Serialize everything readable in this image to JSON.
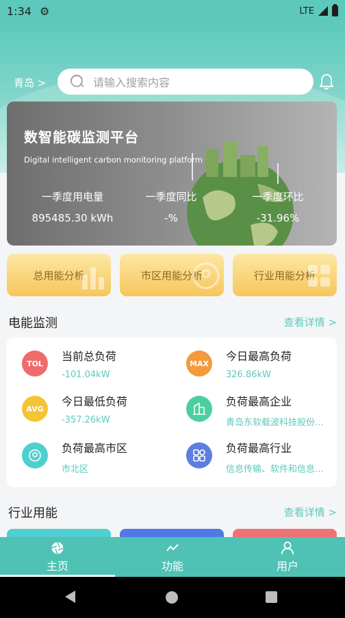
{
  "status_bar": {
    "time": "1:34",
    "network": "LTE"
  },
  "header": {
    "city": "青岛 >",
    "search_placeholder": "请输入搜索内容"
  },
  "hero": {
    "title": "数智能碳监测平台",
    "subtitle": "Digital intelligent carbon monitoring platform",
    "stats": [
      {
        "label": "一季度用电量",
        "value": "895485.30 kWh"
      },
      {
        "label": "一季度同比",
        "value": "-%"
      },
      {
        "label": "一季度环比",
        "value": "-31.96%"
      }
    ]
  },
  "analysis_buttons": [
    {
      "label": "总用能分析"
    },
    {
      "label": "市区用能分析"
    },
    {
      "label": "行业用能分析"
    }
  ],
  "power_monitor": {
    "title": "电能监测",
    "more": "查看详情 >",
    "items": [
      {
        "badge": "TOL",
        "label": "当前总负荷",
        "value": "-101.04kW",
        "color": "#f06b6b"
      },
      {
        "badge": "MAX",
        "label": "今日最高负荷",
        "value": "326.86kW",
        "color": "#f39a3b"
      },
      {
        "badge": "AVG",
        "label": "今日最低负荷",
        "value": "-357.26kW",
        "color": "#f5c434"
      },
      {
        "badge": "",
        "label": "负荷最高企业",
        "value": "青岛东软载波科技股份有限公司",
        "color": "#4ccfa0"
      },
      {
        "badge": "",
        "label": "负荷最高市区",
        "value": "市北区",
        "color": "#4fcfcf"
      },
      {
        "badge": "",
        "label": "负荷最高行业",
        "value": "信息传输、软件和信息技术服务业",
        "color": "#5b7fe0"
      }
    ]
  },
  "industry": {
    "title": "行业用能",
    "more": "查看详情 >",
    "tab_colors": [
      "#4fcfcf",
      "#4f7ae6",
      "#f07272"
    ]
  },
  "bottom_nav": [
    {
      "label": "主页",
      "icon": "home-aperture-icon",
      "active": true
    },
    {
      "label": "功能",
      "icon": "trend-icon",
      "active": false
    },
    {
      "label": "用户",
      "icon": "user-icon",
      "active": false
    }
  ]
}
